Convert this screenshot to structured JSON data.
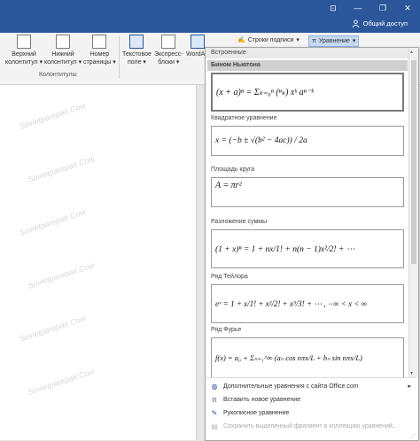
{
  "titlebar": {
    "share_label": "Общий доступ",
    "icons": [
      "ribbon-display-icon",
      "minimize-icon",
      "restore-icon",
      "close-icon",
      "share-person-icon"
    ],
    "icon_glyphs": [
      "⊡",
      "—",
      "❐",
      "✕"
    ],
    "color": "#2b579a"
  },
  "ribbon": {
    "buttons": [
      {
        "label1": "Верхний",
        "label2": "колонтитул ▾"
      },
      {
        "label1": "Нижний",
        "label2": "колонтитул ▾"
      },
      {
        "label1": "Номер",
        "label2": "страницы ▾"
      },
      {
        "label1": "Текстовое",
        "label2": "поле ▾"
      },
      {
        "label1": "Экспресс-",
        "label2": "блоки ▾"
      },
      {
        "label1": "WordArt",
        "label2": ""
      }
    ],
    "group_label": "Колонтитулы",
    "strings_caption": "Строки подписи",
    "equation_label": "Уравнение",
    "equation_symbol": "π",
    "dropdown_arrow": "▾"
  },
  "gallery": {
    "header": "Встроенные",
    "items": [
      {
        "title": "Бином Ньютона",
        "formula": "(x + a)ⁿ = Σₖ₌₀ⁿ (ⁿₖ) xᵏ aⁿ⁻ᵏ"
      },
      {
        "title": "Квадратное уравнение",
        "formula": "x = (−b ± √(b² − 4ac)) / 2a"
      },
      {
        "title": "Площадь круга",
        "formula": "A = πr²"
      },
      {
        "title": "Разложение суммы",
        "formula": "(1 + x)ⁿ = 1 + nx/1! + n(n − 1)x²/2! + ⋯"
      },
      {
        "title": "Ряд Тейлора",
        "formula": "eˣ = 1 + x/1! + x²/2! + x³/3! + ⋯ ,   −∞ < x < ∞"
      },
      {
        "title": "Ряд Фурье",
        "formula": "f(x) = a₀ + Σₙ₌₁^∞ (aₙ cos nπx/L + bₙ sin nπx/L)"
      }
    ],
    "menu": [
      {
        "icon": "globe-doc-icon",
        "glyph": "◍",
        "label": "Дополнительные уравнения с сайта Office.com",
        "has_arrow": true,
        "disabled": false
      },
      {
        "icon": "pi-icon",
        "glyph": "π",
        "label": "Вставить новое уравнение",
        "has_arrow": false,
        "disabled": false
      },
      {
        "icon": "pen-icon",
        "glyph": "✎",
        "label": "Рукописное уравнение",
        "has_arrow": false,
        "disabled": false
      },
      {
        "icon": "save-selection-icon",
        "glyph": "▤",
        "label": "Сохранить выделенный фрагмент в коллекцию уравнений...",
        "has_arrow": false,
        "disabled": true
      }
    ],
    "submenu_arrow": "▸",
    "scroll_up": "▴",
    "scroll_down": "▾",
    "resize_grip": "⋰"
  },
  "document": {
    "watermark_text": "Sovietparepair.Cow"
  }
}
